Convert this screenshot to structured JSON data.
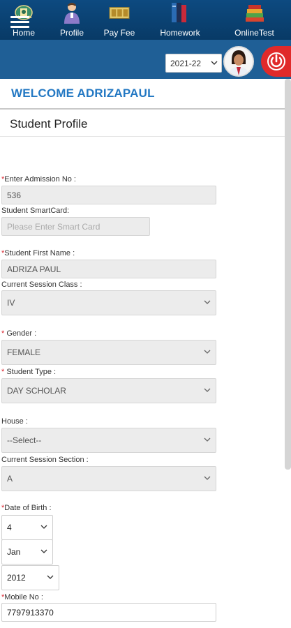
{
  "nav": {
    "items": [
      {
        "label": "Home",
        "icon": "emblem-icon"
      },
      {
        "label": "Profile",
        "icon": "user-icon"
      },
      {
        "label": "Pay Fee",
        "icon": "money-icon"
      },
      {
        "label": "Homework",
        "icon": "books-icon"
      },
      {
        "label": "OnlineTest",
        "icon": "test-books-icon"
      }
    ]
  },
  "header": {
    "session": "2021-22",
    "menu_icon": "hamburger-icon",
    "avatar_icon": "avatar-icon",
    "power_icon": "power-icon"
  },
  "welcome": "WELCOME ADRIZAPAUL",
  "page_title": "Student Profile",
  "form": {
    "admission_label": "Enter Admission No :",
    "admission_value": "536",
    "smartcard_label": "Student SmartCard:",
    "smartcard_placeholder": "Please Enter  Smart Card",
    "first_name_label": "Student First Name :",
    "first_name_value": "ADRIZA  PAUL",
    "class_label": "Current Session Class :",
    "class_value": "IV",
    "gender_label": " Gender :",
    "gender_value": "FEMALE",
    "student_type_label": " Student Type :",
    "student_type_value": "DAY SCHOLAR",
    "house_label": "House :",
    "house_value": "--Select--",
    "section_label": "Current Session Section :",
    "section_value": "A",
    "dob_label": "Date of Birth :",
    "dob_day": "4",
    "dob_month": "Jan",
    "dob_year": "2012",
    "mobile_label": "Mobile No :",
    "mobile_value": "7797913370",
    "required_mark": "*"
  },
  "colors": {
    "nav_bg": "#0d4a80",
    "bar_bg": "#1f5f96",
    "welcome": "#2378c3",
    "required": "#d9232d",
    "power": "#e02a2a"
  }
}
